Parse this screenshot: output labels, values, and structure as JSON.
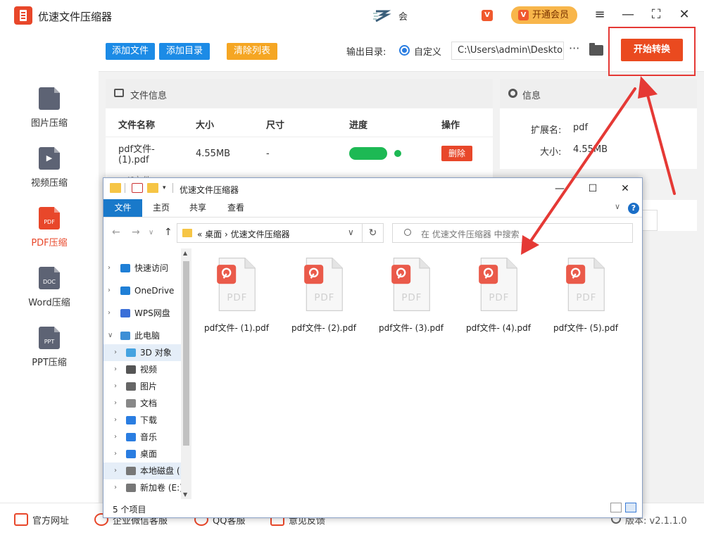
{
  "app": {
    "title": "优速文件压缩器",
    "user_name": "会",
    "vip_label": "开通会员",
    "vip_icon_glyph": "V",
    "window_controls": [
      "≡",
      "—",
      "⛶",
      "✕"
    ]
  },
  "sidebar": {
    "items": [
      {
        "label": "图片压缩",
        "icon_text": "",
        "active": false
      },
      {
        "label": "视频压缩",
        "icon_text": "▶",
        "active": false
      },
      {
        "label": "PDF压缩",
        "icon_text": "PDF",
        "active": true
      },
      {
        "label": "Word压缩",
        "icon_text": "DOC",
        "active": false
      },
      {
        "label": "PPT压缩",
        "icon_text": "PPT",
        "active": false
      }
    ]
  },
  "toolbar": {
    "add_file": "添加文件",
    "add_dir": "添加目录",
    "clear_list": "清除列表",
    "output_label": "输出目录:",
    "radio_label": "自定义",
    "output_path": "C:\\Users\\admin\\Deskto",
    "more": "···",
    "start": "开始转换"
  },
  "file_info": {
    "title": "文件信息",
    "headers": [
      "文件名称",
      "大小",
      "尺寸",
      "进度",
      "操作"
    ],
    "rows": [
      {
        "name_line1": "pdf文件-",
        "name_line2": "(1).pdf",
        "size": "4.55MB",
        "dim": "-",
        "action": "删除"
      }
    ],
    "partial_row": "pdf文件"
  },
  "info": {
    "title": "信息",
    "ext_label": "扩展名:",
    "ext_value": "pdf",
    "size_label": "大小:",
    "size_value": "4.55MB"
  },
  "footer": {
    "items": [
      "官方网址",
      "企业微信客服",
      "QQ客服",
      "意见反馈"
    ],
    "version": "版本: v2.1.1.0"
  },
  "explorer": {
    "title": "优速文件压缩器",
    "controls": [
      "—",
      "☐",
      "✕"
    ],
    "ribbon_tabs": [
      "文件",
      "主页",
      "共享",
      "查看"
    ],
    "help": "?",
    "nav_buttons": [
      "←",
      "→",
      "∨",
      "↑"
    ],
    "address": "«  桌面  ›  优速文件压缩器",
    "search_placeholder": "在 优速文件压缩器 中搜索",
    "nav_items": [
      {
        "label": "快速访问",
        "icon": "star-icon",
        "color": "#1f7fd6"
      },
      {
        "label": "OneDrive",
        "icon": "cloud-icon",
        "color": "#1f7fd6"
      },
      {
        "label": "WPS网盘",
        "icon": "cloud-icon",
        "color": "#3a6fd8"
      },
      {
        "label": "此电脑",
        "icon": "computer-icon",
        "color": "#3d8fd6"
      },
      {
        "label": "3D 对象",
        "icon": "cube-icon",
        "color": "#45a3e0"
      },
      {
        "label": "视频",
        "icon": "film-icon",
        "color": "#555555"
      },
      {
        "label": "图片",
        "icon": "picture-icon",
        "color": "#666666"
      },
      {
        "label": "文档",
        "icon": "document-icon",
        "color": "#888888"
      },
      {
        "label": "下载",
        "icon": "download-icon",
        "color": "#2a7de1"
      },
      {
        "label": "音乐",
        "icon": "music-icon",
        "color": "#2a7de1"
      },
      {
        "label": "桌面",
        "icon": "desktop-icon",
        "color": "#2a7de1"
      },
      {
        "label": "本地磁盘 (",
        "icon": "drive-icon",
        "color": "#777777"
      },
      {
        "label": "新加卷 (E:)",
        "icon": "drive-icon",
        "color": "#777777"
      }
    ],
    "files": [
      {
        "name": "pdf文件- (1).pdf"
      },
      {
        "name": "pdf文件- (2).pdf"
      },
      {
        "name": "pdf文件- (3).pdf"
      },
      {
        "name": "pdf文件- (4).pdf"
      },
      {
        "name": "pdf文件- (5).pdf"
      }
    ],
    "file_badge": "PDF",
    "status": "5 个项目"
  },
  "colors": {
    "brand": "#e8472a",
    "blue_button": "#1c8be6",
    "orange_button": "#f5a623",
    "annotation": "#e53935"
  }
}
